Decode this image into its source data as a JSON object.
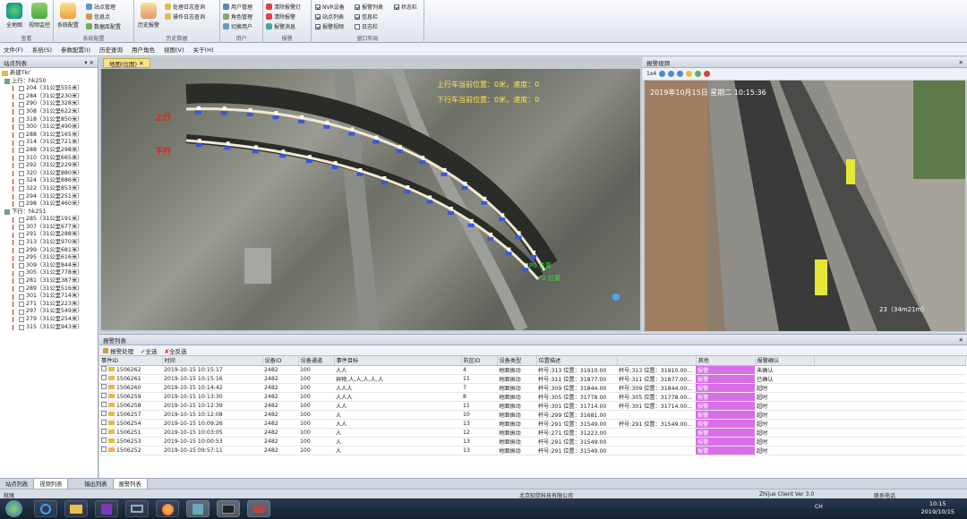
{
  "ribbon": {
    "groups": [
      {
        "title": "查看",
        "big": [
          "全地图",
          "视频监控"
        ]
      },
      {
        "title": "系统配置",
        "big": [
          "系统配置"
        ],
        "small": [
          "站点管理",
          "信息点",
          "数据库配置"
        ]
      },
      {
        "title": "历史数据",
        "big": [
          "历史报警"
        ],
        "small": [
          "处理日志查询",
          "操作日志查询"
        ]
      },
      {
        "title": "用户",
        "small": [
          "用户管理",
          "角色管理",
          "切换用户"
        ]
      },
      {
        "title": "报警",
        "small": [
          "清除报警灯",
          "清除报警",
          "报警消息"
        ]
      },
      {
        "title": "窗口布局",
        "checks": [
          {
            "label": "NVR设备",
            "on": true
          },
          {
            "label": "站点列表",
            "on": true
          },
          {
            "label": "报警视频",
            "on": true
          },
          {
            "label": "报警列表",
            "on": true
          },
          {
            "label": "信息栏",
            "on": true
          },
          {
            "label": "日志栏",
            "on": false
          },
          {
            "label": "状态栏",
            "on": true
          }
        ]
      }
    ]
  },
  "menu": [
    "文件(F)",
    "系统(S)",
    "参数配置(I)",
    "历史查询",
    "用户角色",
    "视图(V)",
    "关于(H)"
  ],
  "left_panel": {
    "title": "站点列表",
    "root": "新建Tkr",
    "up_group": "上行：hk250",
    "up_items": [
      "204（31公里555米）",
      "284（31公里230米）",
      "290（31公里328米）",
      "308（31公里622米）",
      "318（31公里850米）",
      "300（31公里490米）",
      "288（31公里165米）",
      "314（31公里721米）",
      "288（31公里298米）",
      "310（31公里665米）",
      "292（31公里229米）",
      "320（31公里880米）",
      "324（31公里886米）",
      "322（31公里853米）",
      "294（31公里251米）",
      "298（31公里460米）"
    ],
    "down_group": "下行：hk251",
    "down_items": [
      "285（31公里191米）",
      "307（31公里677米）",
      "291（31公里288米）",
      "313（31公里970米）",
      "299（31公里681米）",
      "295（31公里616米）",
      "309（31公里844米）",
      "305（31公里778米）",
      "281（31公里387米）",
      "289（31公里516米）",
      "301（31公里714米）",
      "271（31公里223米）",
      "297（31公里549米）",
      "279（31公里254米）",
      "315（31公里943米）"
    ]
  },
  "map_panel": {
    "tab": "地图(位图)",
    "up_status": "上行车当前位置：0米，速度：0",
    "down_status": "下行车当前位置：0米，速度：0",
    "label_up": "上行",
    "label_down": "下行",
    "marker_1": "P0 位置",
    "marker_2": "P2 位置"
  },
  "video_panel": {
    "title": "报警视频",
    "timestamp": "2019年10月15日 星期二 10:15:36",
    "caption": "23（34m21m）",
    "toolbar_label": "1x4"
  },
  "alarm_panel": {
    "title": "报警列表",
    "toolbar": [
      "报警处理",
      "全选",
      "全反选"
    ],
    "columns": [
      "事件ID",
      "时间",
      "设备ID",
      "设备通道",
      "事件目标",
      "防区ID",
      "设备类型",
      "位置描述",
      "",
      "其他",
      "报警确认"
    ],
    "rows": [
      [
        "1506262",
        "2019-10-15 10:15:17",
        "2482",
        "100",
        "人人",
        "4",
        "地面振动",
        "杆号:313 位置：31910.00",
        "杆号:313 位置：31910.00...",
        "报警",
        "未确认"
      ],
      [
        "1506261",
        "2019-10-15 10:15:16",
        "2482",
        "100",
        "异物,人,人,人,人,人",
        "11",
        "地面振动",
        "杆号:311 位置：31877.00",
        "杆号:311 位置：31877.00...",
        "报警",
        "已确认"
      ],
      [
        "1506260",
        "2019-10-15 10:14:42",
        "2482",
        "100",
        "人人人",
        "7",
        "地面振动",
        "杆号:309 位置：31844.00",
        "杆号:309 位置：31844.00...",
        "报警",
        "超时"
      ],
      [
        "1506259",
        "2019-10-15 10:13:30",
        "2482",
        "100",
        "人人人",
        "8",
        "地面振动",
        "杆号:305 位置：31778.00",
        "杆号:305 位置：31778.00...",
        "报警",
        "超时"
      ],
      [
        "1506258",
        "2019-10-15 10:12:39",
        "2482",
        "100",
        "人人",
        "11",
        "地面振动",
        "杆号:301 位置：31714.00",
        "杆号:301 位置：31714.00...",
        "报警",
        "超时"
      ],
      [
        "1506257",
        "2019-10-15 10:12:08",
        "2482",
        "100",
        "人",
        "10",
        "地面振动",
        "杆号:299 位置：31681.00",
        "",
        "报警",
        "超时"
      ],
      [
        "1506254",
        "2019-10-15 10:09:26",
        "2482",
        "100",
        "人人",
        "13",
        "地面振动",
        "杆号:291 位置：31549.00",
        "杆号:291 位置：31549.00...",
        "报警",
        "超时"
      ],
      [
        "1506251",
        "2019-10-15 10:03:05",
        "2482",
        "100",
        "人",
        "12",
        "地面振动",
        "杆号:271 位置：31223.00",
        "",
        "报警",
        "超时"
      ],
      [
        "1506253",
        "2019-10-15 10:00:53",
        "2482",
        "100",
        "人",
        "13",
        "地面振动",
        "杆号:291 位置：31549.00",
        "",
        "报警",
        "超时"
      ],
      [
        "1506252",
        "2019-10-15 09:57:11",
        "2482",
        "100",
        "人",
        "13",
        "地面振动",
        "杆号:291 位置：31549.00",
        "",
        "报警",
        "超时"
      ]
    ]
  },
  "bottom_tabs": [
    "站点列表",
    "视频列表",
    "输出列表",
    "报警列表"
  ],
  "status": {
    "left": "就绪",
    "company": "北京知觉科技有限公司",
    "version": "Zhijue Client Ver 3.0",
    "right": "联系电话"
  },
  "taskbar": {
    "time": "10:15",
    "date": "2019/10/15",
    "lang": "CH"
  },
  "colors": {
    "track_up": "#f3e8d0",
    "alarm_pink": "#d96fe8",
    "label_red": "#e02020"
  }
}
